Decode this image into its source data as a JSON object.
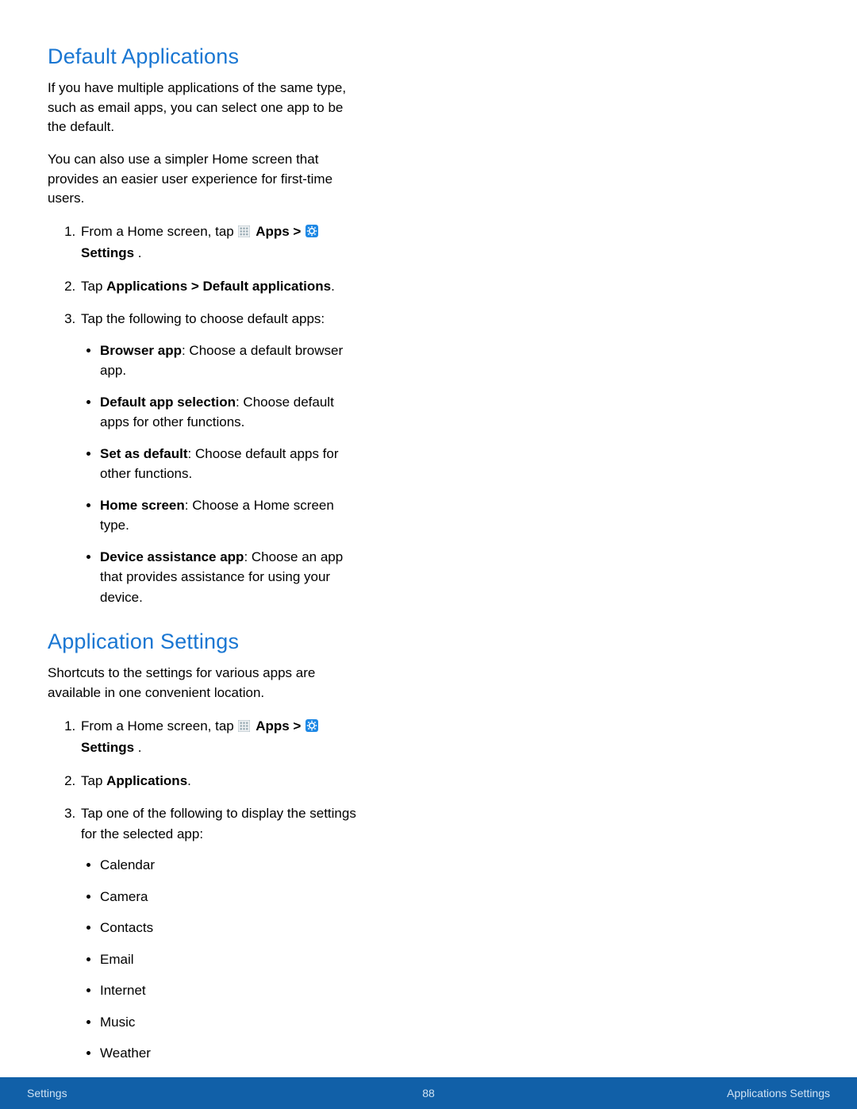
{
  "section1": {
    "heading": "Default Applications",
    "para1": "If you have multiple applications of the same type, such as email apps, you can select one app to be the default.",
    "para2": "You can also use a simpler Home screen that provides an easier user experience for first-time users.",
    "step1_pre": "From a Home screen, tap ",
    "step1_apps": "Apps",
    "step1_gt": " > ",
    "step1_settings": "Settings",
    "step1_post": " .",
    "step2_pre": "Tap ",
    "step2_bold": "Applications > Default applications",
    "step2_post": ".",
    "step3": "Tap the following to choose default apps:",
    "bullets": {
      "b1_bold": "Browser app",
      "b1_rest": ": Choose a default browser app.",
      "b2_bold": "Default app selection",
      "b2_rest": ": Choose default apps for other functions.",
      "b3_bold": "Set as default",
      "b3_rest": ": Choose default apps for other functions.",
      "b4_bold": "Home screen",
      "b4_rest": ": Choose a Home screen type.",
      "b5_bold": "Device assistance app",
      "b5_rest": ": Choose an app that provides assistance for using your device."
    }
  },
  "section2": {
    "heading": "Application Settings",
    "para1": "Shortcuts to the settings for various apps are available in one convenient location.",
    "step1_pre": "From a Home screen, tap ",
    "step1_apps": "Apps",
    "step1_gt": " > ",
    "step1_settings": "Settings",
    "step1_post": " .",
    "step2_pre": "Tap ",
    "step2_bold": "Applications",
    "step2_post": ".",
    "step3": "Tap one of the following to display the settings for the selected app:",
    "apps": {
      "a1": "Calendar",
      "a2": "Camera",
      "a3": "Contacts",
      "a4": "Email",
      "a5": "Internet",
      "a6": "Music",
      "a7": "Weather"
    }
  },
  "footer": {
    "left": "Settings",
    "center": "88",
    "right": "Applications Settings"
  }
}
